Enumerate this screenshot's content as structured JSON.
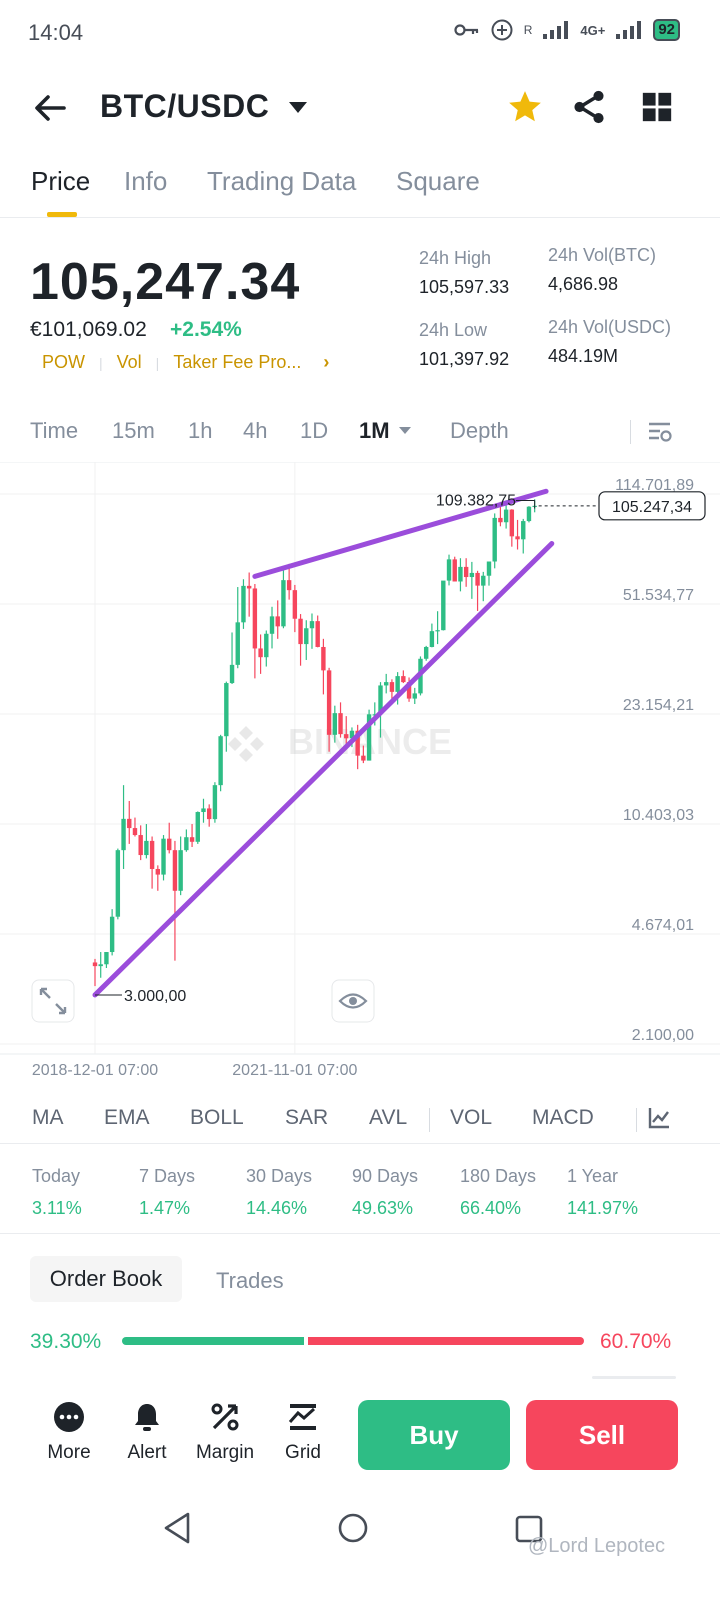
{
  "status_bar": {
    "time": "14:04",
    "network": "4G+",
    "battery": "92"
  },
  "header": {
    "pair": "BTC/USDC"
  },
  "tabs": [
    {
      "label": "Price",
      "active": true
    },
    {
      "label": "Info"
    },
    {
      "label": "Trading Data"
    },
    {
      "label": "Square"
    }
  ],
  "price": {
    "last": "105,247.34",
    "fiat": "€101,069.02",
    "change": "+2.54%",
    "tags": [
      "POW",
      "Vol",
      "Taker Fee Pro..."
    ]
  },
  "stats": {
    "high_label": "24h High",
    "high": "105,597.33",
    "low_label": "24h Low",
    "low": "101,397.92",
    "vol_btc_label": "24h Vol(BTC)",
    "vol_btc": "4,686.98",
    "vol_usdc_label": "24h Vol(USDC)",
    "vol_usdc": "484.19M"
  },
  "intervals": [
    "Time",
    "15m",
    "1h",
    "4h",
    "1D",
    "1M",
    "Depth"
  ],
  "active_interval": "1M",
  "chart_data": {
    "type": "candlestick",
    "scale": "log",
    "y_ticks": [
      "114.701,89",
      "51.534,77",
      "23.154,21",
      "10.403,03",
      "4.674,01",
      "2.100,00"
    ],
    "y_tick_values": [
      114701.89,
      51534.77,
      23154.21,
      10403.03,
      4674.01,
      2100
    ],
    "x_ticks": [
      "2018-12-01 07:00",
      "2021-11-01 07:00"
    ],
    "current_price_label": "105.247,34",
    "current_price": 105247.34,
    "high_marker_label": "109.382,75",
    "high_marker": 109382.75,
    "low_marker_label": "3.000,00",
    "low_marker": 3000,
    "watermark": "BINANCE",
    "trendlines": [
      {
        "from": [
          "2021-04",
          63000
        ],
        "to": [
          "2025-07",
          117000
        ]
      },
      {
        "from": [
          "2018-12",
          3000
        ],
        "to": [
          "2025-08",
          80000
        ]
      }
    ],
    "candles": [
      [
        3800,
        3900,
        3200,
        3700
      ],
      [
        3700,
        4100,
        3400,
        3750
      ],
      [
        3750,
        4100,
        3650,
        4100
      ],
      [
        4100,
        5600,
        4000,
        5300
      ],
      [
        5300,
        8700,
        5200,
        8600
      ],
      [
        8600,
        13800,
        7500,
        10800
      ],
      [
        10800,
        12300,
        9000,
        10100
      ],
      [
        10100,
        10900,
        9500,
        9600
      ],
      [
        9600,
        10300,
        8000,
        8300
      ],
      [
        8300,
        10400,
        8100,
        9200
      ],
      [
        9200,
        9500,
        6500,
        7500
      ],
      [
        7500,
        7700,
        6400,
        7200
      ],
      [
        7200,
        9600,
        6900,
        9350
      ],
      [
        9350,
        10500,
        8400,
        8600
      ],
      [
        8600,
        9200,
        3850,
        6400
      ],
      [
        6400,
        9500,
        6200,
        8600
      ],
      [
        8600,
        10000,
        8500,
        9450
      ],
      [
        9450,
        10400,
        8800,
        9140
      ],
      [
        9140,
        11400,
        9000,
        11350
      ],
      [
        11350,
        12500,
        10500,
        11650
      ],
      [
        11650,
        12000,
        10200,
        10780
      ],
      [
        10780,
        14100,
        10500,
        13800
      ],
      [
        13800,
        19900,
        13200,
        19700
      ],
      [
        19700,
        29300,
        17600,
        29000
      ],
      [
        29000,
        41900,
        28800,
        33100
      ],
      [
        33100,
        58300,
        32300,
        45100
      ],
      [
        45100,
        61700,
        43000,
        58800
      ],
      [
        58800,
        64800,
        47000,
        57700
      ],
      [
        57700,
        59600,
        30000,
        37300
      ],
      [
        37300,
        41300,
        31000,
        35000
      ],
      [
        35000,
        42500,
        32700,
        41500
      ],
      [
        41500,
        50500,
        37300,
        47100
      ],
      [
        47100,
        52900,
        40000,
        43800
      ],
      [
        43800,
        67000,
        43200,
        61300
      ],
      [
        61300,
        69000,
        53200,
        57000
      ],
      [
        57000,
        59200,
        42000,
        46300
      ],
      [
        46300,
        47900,
        32900,
        38500
      ],
      [
        38500,
        45800,
        34300,
        43200
      ],
      [
        43200,
        48100,
        37200,
        45500
      ],
      [
        45500,
        47400,
        37600,
        37700
      ],
      [
        37700,
        40000,
        26700,
        31800
      ],
      [
        31800,
        32400,
        17600,
        19900
      ],
      [
        19900,
        24600,
        18800,
        23300
      ],
      [
        23300,
        25200,
        19500,
        20000
      ],
      [
        20000,
        22800,
        18100,
        19400
      ],
      [
        19400,
        21000,
        18200,
        20500
      ],
      [
        20500,
        21400,
        15500,
        17100
      ],
      [
        17100,
        18400,
        16200,
        16500
      ],
      [
        16500,
        23900,
        16500,
        23100
      ],
      [
        23100,
        25200,
        21300,
        23100
      ],
      [
        23100,
        29200,
        19500,
        28500
      ],
      [
        28500,
        31000,
        26900,
        29200
      ],
      [
        29200,
        29800,
        25800,
        27200
      ],
      [
        27200,
        31400,
        24800,
        30500
      ],
      [
        30500,
        31800,
        29000,
        29200
      ],
      [
        29200,
        30200,
        25300,
        25900
      ],
      [
        25900,
        28000,
        24900,
        26900
      ],
      [
        26900,
        35200,
        26500,
        34600
      ],
      [
        34600,
        38000,
        34100,
        37700
      ],
      [
        37700,
        44700,
        37600,
        42300
      ],
      [
        42300,
        48900,
        38500,
        42600
      ],
      [
        42600,
        52900,
        42500,
        61100
      ],
      [
        61100,
        73800,
        59000,
        71300
      ],
      [
        71300,
        72700,
        60800,
        60700
      ],
      [
        60700,
        71900,
        56500,
        67500
      ],
      [
        67500,
        71900,
        58400,
        62700
      ],
      [
        62700,
        70000,
        53500,
        64600
      ],
      [
        64600,
        65600,
        49000,
        58900
      ],
      [
        58900,
        65100,
        52600,
        63300
      ],
      [
        63300,
        66500,
        58900,
        70200
      ],
      [
        70200,
        99600,
        66800,
        96400
      ],
      [
        96400,
        108300,
        90700,
        93400
      ],
      [
        93400,
        109600,
        89200,
        102400
      ],
      [
        102400,
        102700,
        78200,
        84300
      ],
      [
        84300,
        95000,
        76600,
        82500
      ],
      [
        82500,
        95700,
        74400,
        94200
      ],
      [
        94200,
        105000,
        93300,
        104600
      ],
      [
        104600,
        110400,
        100400,
        105247
      ]
    ]
  },
  "indicators": [
    "MA",
    "EMA",
    "BOLL",
    "SAR",
    "AVL",
    "VOL",
    "MACD"
  ],
  "performance": [
    {
      "label": "Today",
      "value": "3.11%"
    },
    {
      "label": "7 Days",
      "value": "1.47%"
    },
    {
      "label": "30 Days",
      "value": "14.46%"
    },
    {
      "label": "90 Days",
      "value": "49.63%"
    },
    {
      "label": "180 Days",
      "value": "66.40%"
    },
    {
      "label": "1 Year",
      "value": "141.97%"
    }
  ],
  "order_book": {
    "tab_active": "Order Book",
    "tab_other": "Trades",
    "bid_pct": "39.30%",
    "ask_pct": "60.70%",
    "bid_fraction": 0.393
  },
  "actions": [
    "More",
    "Alert",
    "Margin",
    "Grid"
  ],
  "buy_label": "Buy",
  "sell_label": "Sell",
  "credit": "@Lord Lepotec"
}
